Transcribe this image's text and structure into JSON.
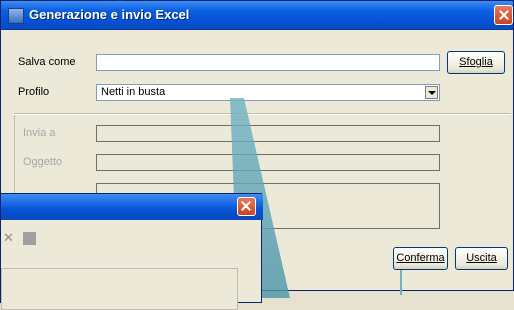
{
  "window": {
    "title": "Generazione e invio Excel",
    "icon": "excel-app-icon",
    "title_color": "#ffffff",
    "titlebar_color": "#0552d6"
  },
  "form": {
    "save_as_label": "Salva come",
    "save_as_value": "",
    "browse_label": "Sfoglia",
    "profile_label": "Profilo",
    "profile_value": "Netti in busta",
    "send_to_label": "Invia a",
    "subject_label": "Oggetto"
  },
  "actions": {
    "confirm_label": "Conferma",
    "exit_label": "Uscita"
  },
  "inner_window": {
    "toolbar_icons": [
      "delete-icon",
      "stop-icon"
    ]
  }
}
